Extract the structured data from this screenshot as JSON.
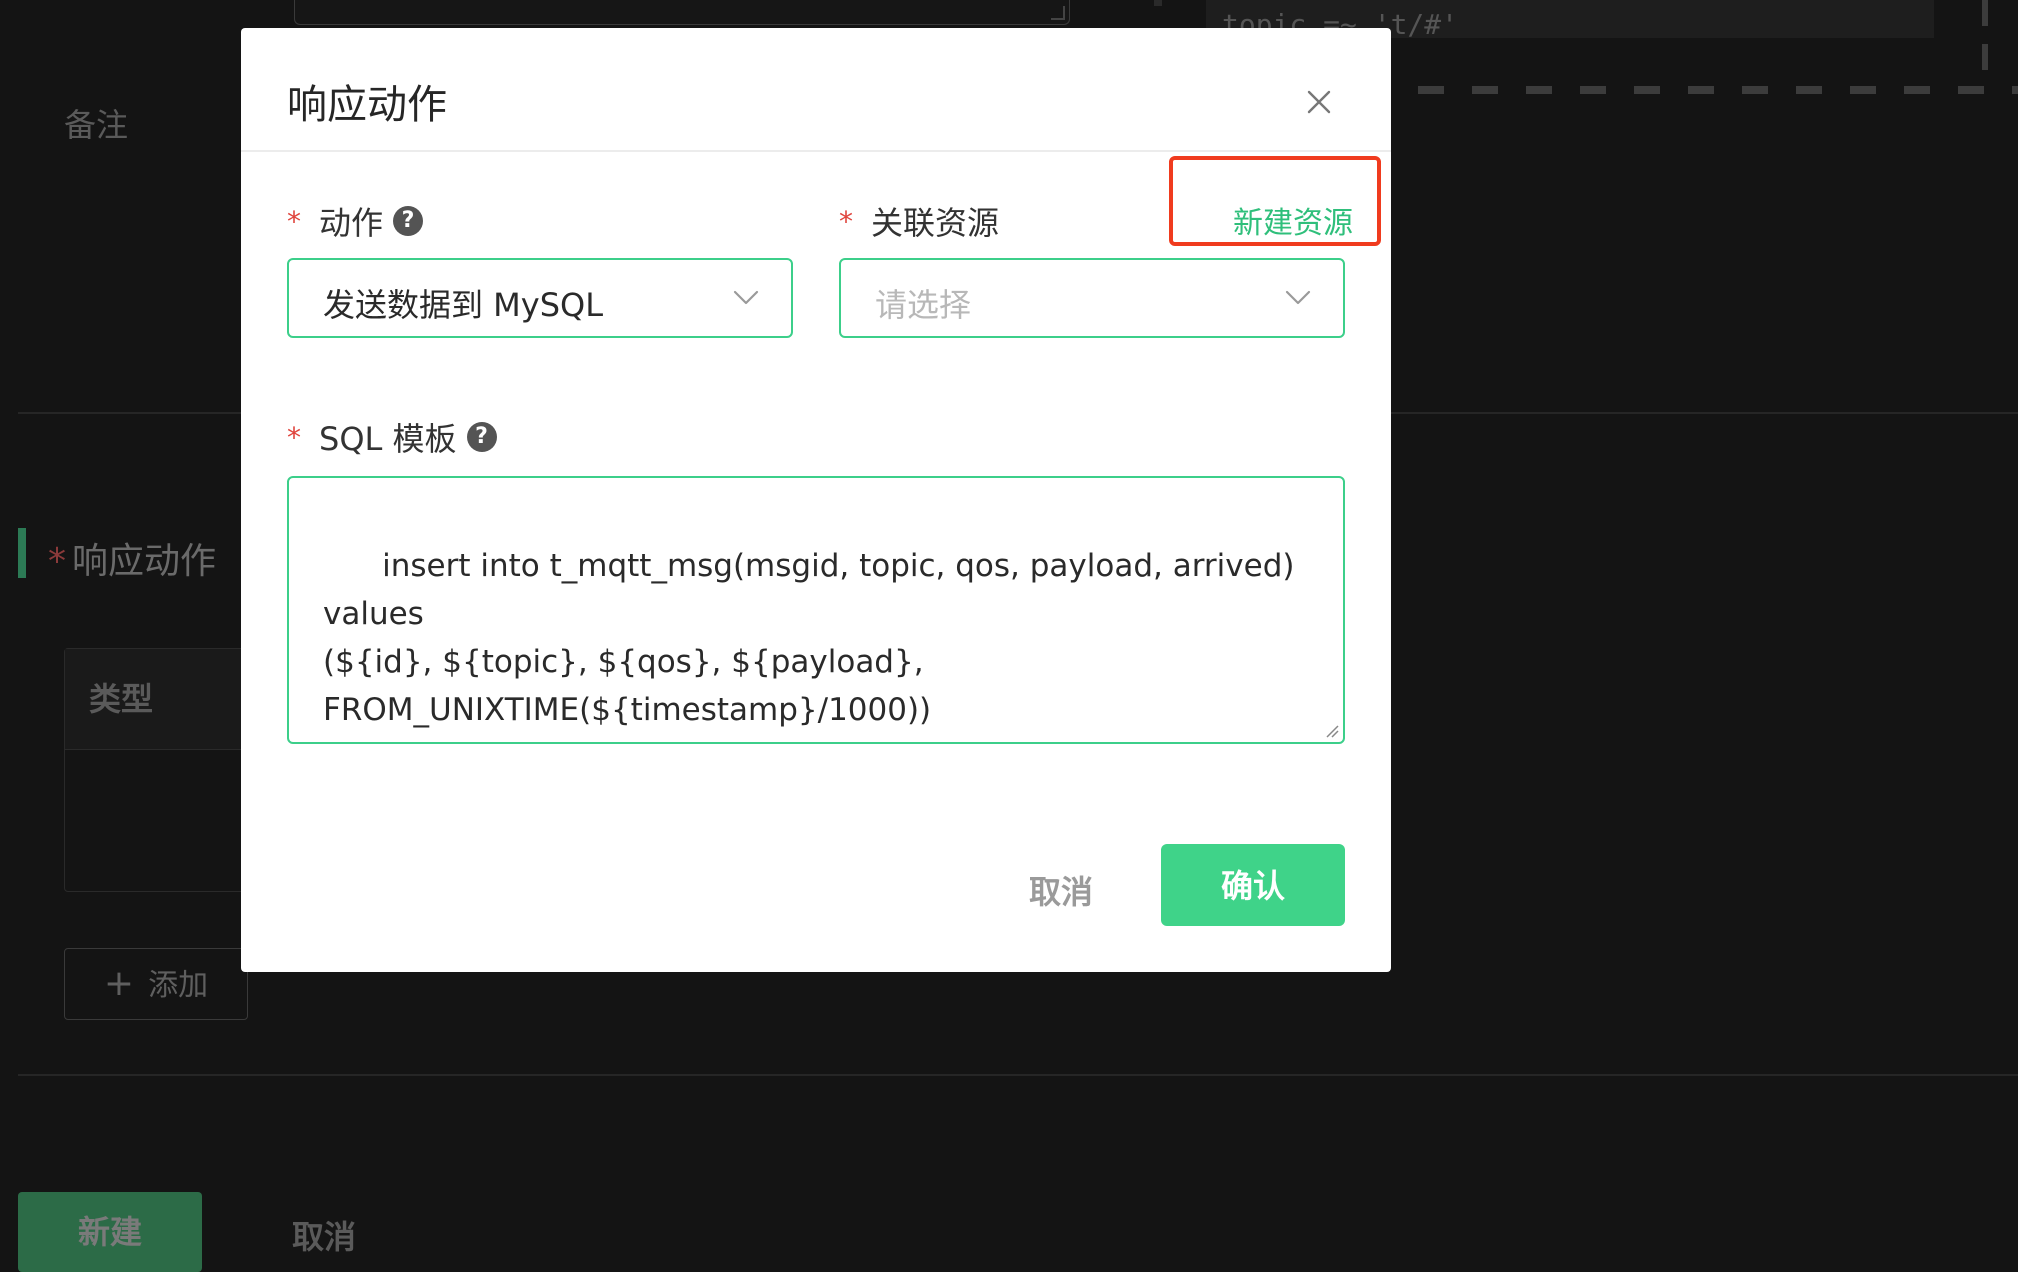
{
  "background": {
    "sql_snippet": "topic =~ 't/#'",
    "note_label": "备注",
    "section_title": "响应动作",
    "section_required_mark": "*",
    "section_title_suffix": "",
    "table_header_type": "类型",
    "add_button_label": "添加",
    "create_button_label": "新建",
    "cancel_link_label": "取消"
  },
  "modal": {
    "title": "响应动作",
    "action": {
      "label": "动作",
      "required_mark": "*",
      "help": "?",
      "selected_value": "发送数据到 MySQL"
    },
    "resource": {
      "label": "关联资源",
      "required_mark": "*",
      "placeholder": "请选择",
      "new_resource_link": "新建资源"
    },
    "sql_template": {
      "label": "SQL 模板",
      "required_mark": "*",
      "help": "?",
      "value": "insert into t_mqtt_msg(msgid, topic, qos, payload, arrived) values\n(${id}, ${topic}, ${qos}, ${payload},\nFROM_UNIXTIME(${timestamp}/1000))"
    },
    "cancel_label": "取消",
    "confirm_label": "确认"
  },
  "colors": {
    "accent_green": "#3fd389",
    "link_green": "#2fbf7b",
    "required_red": "#e0443c",
    "highlight_red": "#f03b1e"
  },
  "icons": {
    "close": "close-icon",
    "help": "question-circle-icon",
    "dropdown": "chevron-down-icon",
    "add": "plus-icon"
  }
}
